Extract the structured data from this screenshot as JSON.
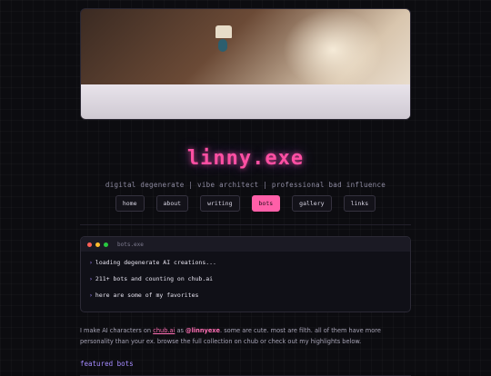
{
  "site": {
    "title": "linny.exe",
    "tagline": "digital degenerate | vibe architect | professional bad influence"
  },
  "nav": [
    {
      "label": "home",
      "active": false
    },
    {
      "label": "about",
      "active": false
    },
    {
      "label": "writing",
      "active": false
    },
    {
      "label": "bots",
      "active": true
    },
    {
      "label": "gallery",
      "active": false
    },
    {
      "label": "links",
      "active": false
    }
  ],
  "terminal": {
    "title": "bots.exe",
    "dot_colors": [
      "#ff5f57",
      "#febc2e",
      "#28c840"
    ],
    "lines": [
      "loading degenerate AI creations...",
      "211+ bots and counting on chub.ai",
      "here are some of my favorites"
    ]
  },
  "intro": {
    "part1": "I make AI characters on ",
    "link": "chub.ai",
    "part2": " as ",
    "handle": "@linnyexe",
    "part3": ". some are cute. most are filth. all of them have more personality than your ex. browse the full collection on chub or check out my highlights below."
  },
  "section": {
    "featured_title": "featured bots"
  },
  "colors": {
    "accent_pink": "#ff5fa8",
    "accent_purple": "#a58bff",
    "background": "#0c0c10"
  }
}
